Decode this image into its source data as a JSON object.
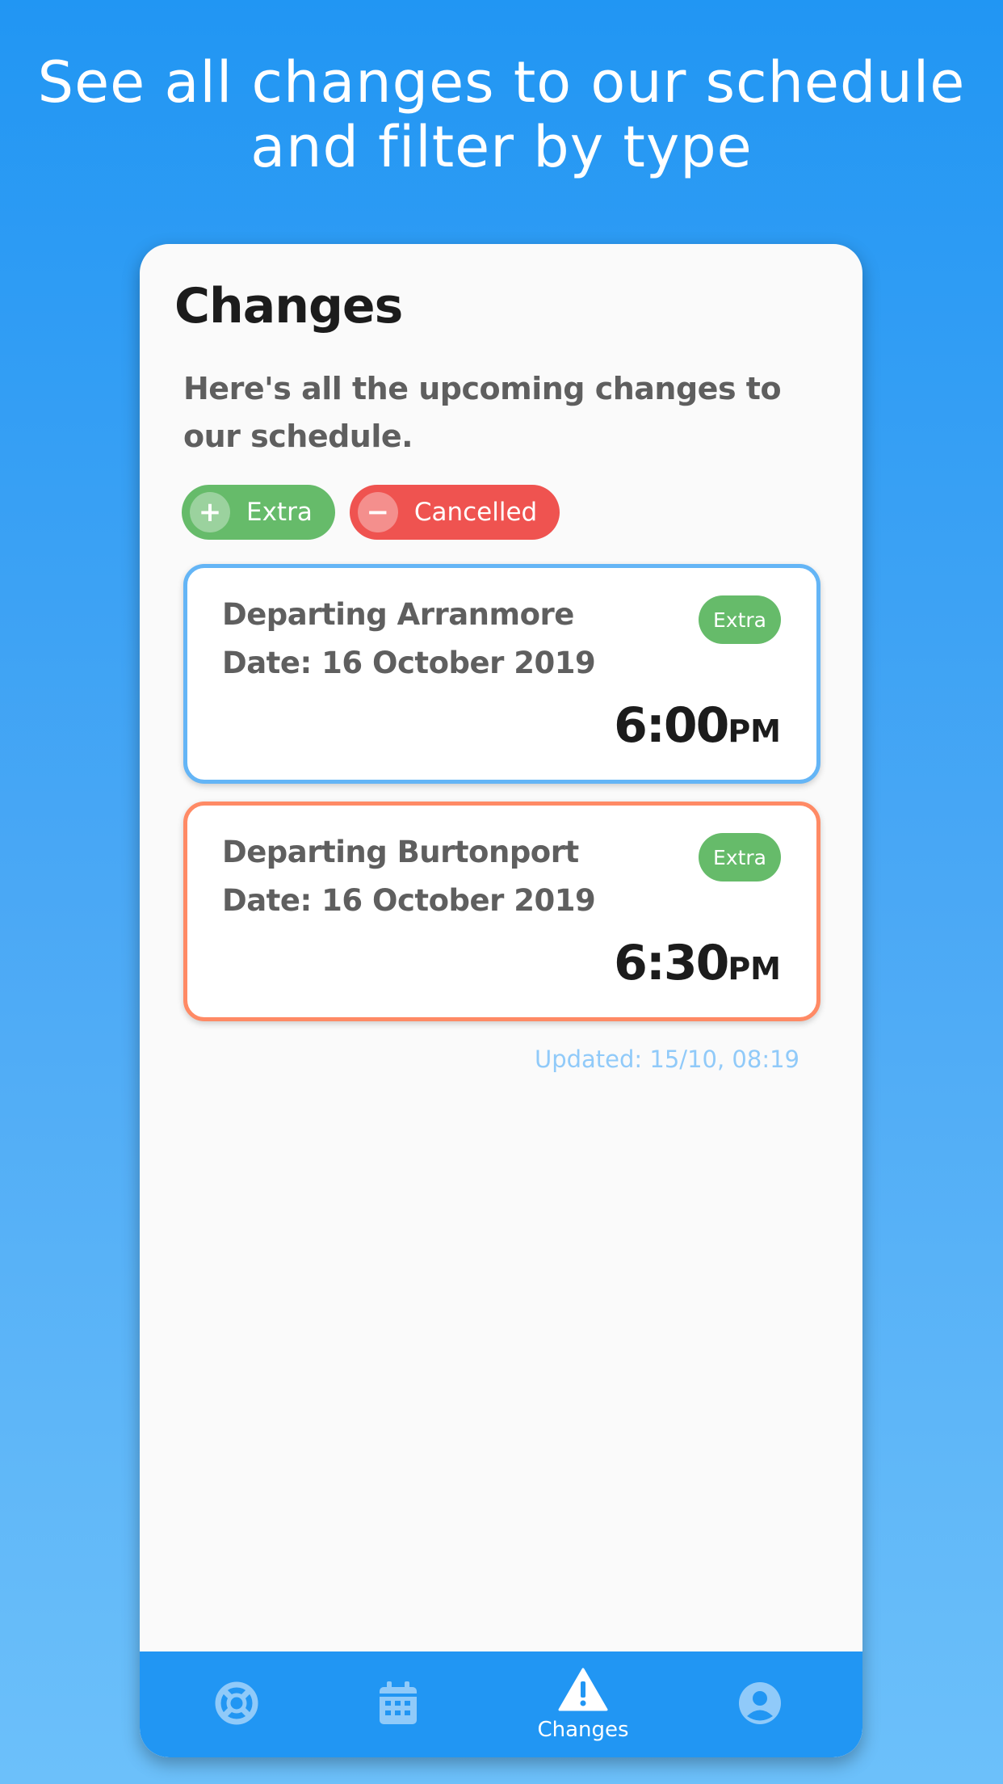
{
  "headline": "See all changes to our schedule and filter by type",
  "page": {
    "title": "Changes",
    "subtitle": "Here's all the upcoming changes to our schedule."
  },
  "filters": [
    {
      "label": "Extra",
      "icon": "plus-icon",
      "color": "#66bb6a"
    },
    {
      "label": "Cancelled",
      "icon": "minus-icon",
      "color": "#ef5350"
    }
  ],
  "changes": [
    {
      "route": "Departing Arranmore",
      "date": "Date: 16 October 2019",
      "badge": "Extra",
      "time": "6:00",
      "ampm": "PM",
      "border_color": "#64b5f6"
    },
    {
      "route": "Departing Burtonport",
      "date": "Date: 16 October 2019",
      "badge": "Extra",
      "time": "6:30",
      "ampm": "PM",
      "border_color": "#ff8a65"
    }
  ],
  "updated": "Updated: 15/10, 08:19",
  "nav": {
    "items": [
      {
        "icon": "lifebuoy-icon",
        "label": ""
      },
      {
        "icon": "calendar-icon",
        "label": ""
      },
      {
        "icon": "warning-icon",
        "label": "Changes"
      },
      {
        "icon": "account-icon",
        "label": ""
      }
    ],
    "active": "Changes"
  },
  "colors": {
    "primary": "#2196f3",
    "extra": "#66bb6a",
    "cancelled": "#ef5350",
    "updated_text": "#90caf9"
  }
}
